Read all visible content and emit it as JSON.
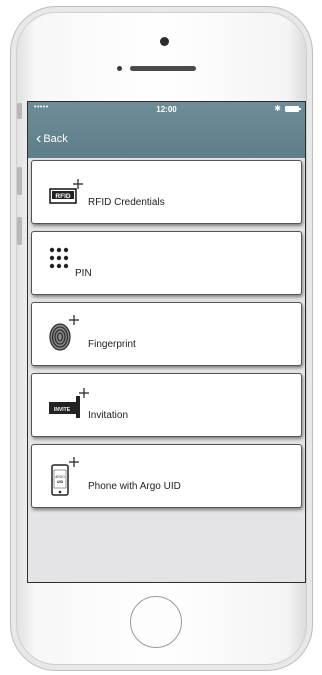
{
  "status_bar": {
    "signal": "•••••",
    "time": "12:00",
    "bluetooth": "✱"
  },
  "nav": {
    "back_label": "Back",
    "back_icon": "chevron-left-icon"
  },
  "items": [
    {
      "label": "RFID Credentials",
      "icon": "rfid-card-icon",
      "icon_text": "RFID"
    },
    {
      "label": "PIN",
      "icon": "keypad-icon"
    },
    {
      "label": "Fingerprint",
      "icon": "fingerprint-icon"
    },
    {
      "label": "Invitation",
      "icon": "invite-ticket-icon",
      "icon_text": "INVITE"
    },
    {
      "label": "Phone with Argo UID",
      "icon": "phone-uid-icon",
      "icon_text": "ARGO UID"
    }
  ],
  "colors": {
    "nav_background": "#6a8a95",
    "screen_background": "#e4e4e6",
    "card_background": "#ffffff"
  }
}
